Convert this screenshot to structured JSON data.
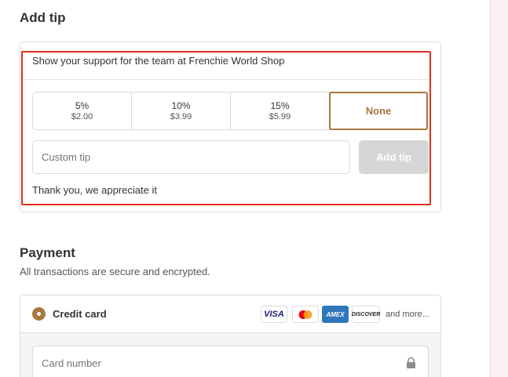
{
  "tip": {
    "title": "Add tip",
    "intro": "Show your support for the team at Frenchie World Shop",
    "options": [
      {
        "pct": "5%",
        "amount": "$2.00"
      },
      {
        "pct": "10%",
        "amount": "$3.99"
      },
      {
        "pct": "15%",
        "amount": "$5.99"
      },
      {
        "pct": "None",
        "amount": ""
      }
    ],
    "selected": "None",
    "custom_placeholder": "Custom tip",
    "add_button": "Add tip",
    "thanks": "Thank you, we appreciate it"
  },
  "payment": {
    "title": "Payment",
    "subtitle": "All transactions are secure and encrypted.",
    "method": "Credit card",
    "logos": {
      "visa": "VISA",
      "amex": "AMEX",
      "discover": "DISCOVER"
    },
    "and_more": "and more...",
    "card_number_placeholder": "Card number"
  },
  "colors": {
    "accent": "#a8773b",
    "highlight": "#e02d1c",
    "disabled_button": "#d6d6d6"
  },
  "icons": {
    "lock": "lock-icon",
    "radio": "radio-selected-icon"
  }
}
